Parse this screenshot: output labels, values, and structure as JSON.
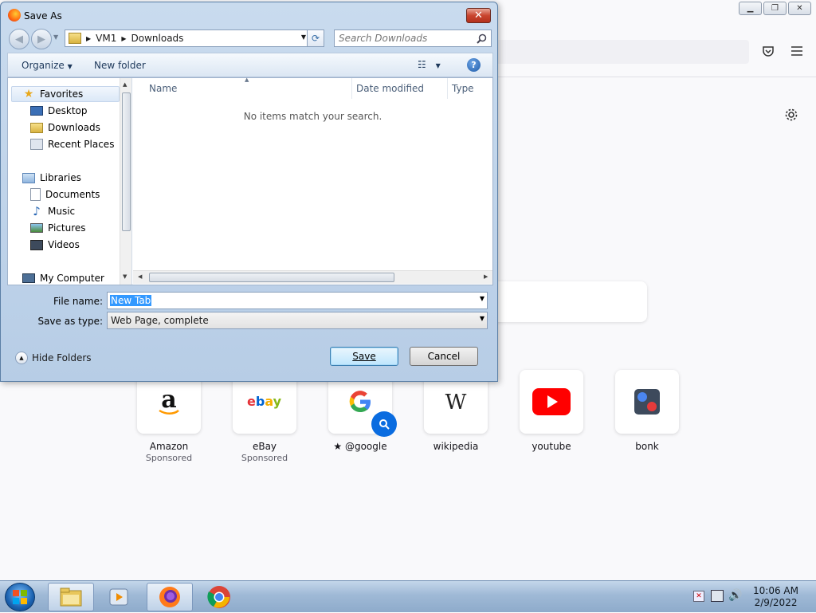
{
  "dialog": {
    "title": "Save As",
    "close_label": "✕",
    "breadcrumb": [
      "VM1",
      "Downloads"
    ],
    "search_placeholder": "Search Downloads",
    "organize_label": "Organize",
    "new_folder_label": "New folder",
    "nav_items": [
      {
        "label": "Favorites",
        "icon": "star-icon"
      },
      {
        "label": "Desktop",
        "icon": "desktop-icon"
      },
      {
        "label": "Downloads",
        "icon": "downloads-folder-icon"
      },
      {
        "label": "Recent Places",
        "icon": "recent-places-icon"
      },
      {
        "label": "Libraries",
        "icon": "libraries-icon"
      },
      {
        "label": "Documents",
        "icon": "documents-icon"
      },
      {
        "label": "Music",
        "icon": "music-icon"
      },
      {
        "label": "Pictures",
        "icon": "pictures-icon"
      },
      {
        "label": "Videos",
        "icon": "videos-icon"
      },
      {
        "label": "My Computer",
        "icon": "computer-icon"
      }
    ],
    "columns": [
      "Name",
      "Date modified",
      "Type"
    ],
    "empty_message": "No items match your search.",
    "file_name_label": "File name:",
    "file_name_value": "New Tab",
    "save_type_label": "Save as type:",
    "save_type_value": "Web Page, complete",
    "hide_folders_label": "Hide Folders",
    "save_label": "Save",
    "cancel_label": "Cancel"
  },
  "browser": {
    "tiles": [
      {
        "title": "Amazon",
        "sub": "Sponsored",
        "icon": "amazon-logo-icon"
      },
      {
        "title": "eBay",
        "sub": "Sponsored",
        "icon": "ebay-logo-icon"
      },
      {
        "title": "@google",
        "sub": "",
        "icon": "google-logo-icon"
      },
      {
        "title": "wikipedia",
        "sub": "",
        "icon": "wikipedia-logo-icon"
      },
      {
        "title": "youtube",
        "sub": "",
        "icon": "youtube-logo-icon"
      },
      {
        "title": "bonk",
        "sub": "",
        "icon": "bonk-logo-icon"
      }
    ]
  },
  "taskbar": {
    "time": "10:06 AM",
    "date": "2/9/2022"
  }
}
